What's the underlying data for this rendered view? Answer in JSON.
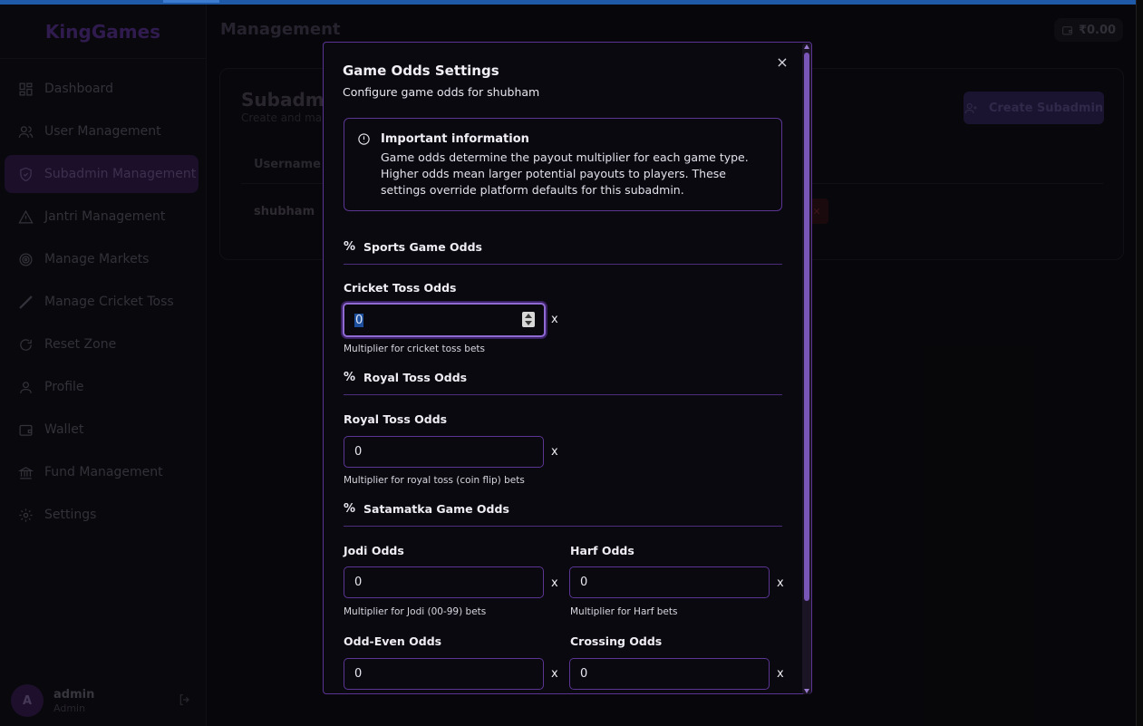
{
  "app": {
    "logo": "KingGames"
  },
  "sidebar": {
    "items": [
      {
        "label": "Dashboard",
        "icon": "dashboard-icon"
      },
      {
        "label": "User Management",
        "icon": "users-icon"
      },
      {
        "label": "Subadmin Management",
        "icon": "shield-icon",
        "active": true
      },
      {
        "label": "Jantri Management",
        "icon": "warning-triangle-icon"
      },
      {
        "label": "Manage Markets",
        "icon": "target-icon"
      },
      {
        "label": "Manage Cricket Toss",
        "icon": "bat-icon"
      },
      {
        "label": "Reset Zone",
        "icon": "refresh-icon"
      },
      {
        "label": "Profile",
        "icon": "user-icon"
      },
      {
        "label": "Wallet",
        "icon": "wallet-icon"
      },
      {
        "label": "Fund Management",
        "icon": "bank-icon"
      },
      {
        "label": "Settings",
        "icon": "gear-icon"
      }
    ],
    "user": {
      "avatar": "A",
      "name": "admin",
      "role": "Admin"
    }
  },
  "header": {
    "title": "Management",
    "balance": "₹0.00"
  },
  "page": {
    "title": "Subadmin",
    "subtitle": "Create and mana",
    "create_button": "Create Subadmin",
    "table": {
      "columns": [
        "Username"
      ],
      "rows": [
        [
          "shubham"
        ]
      ]
    }
  },
  "modal": {
    "title": "Game Odds Settings",
    "subtitle": "Configure game odds for shubham",
    "close": "×",
    "info": {
      "title": "Important information",
      "text": "Game odds determine the payout multiplier for each game type. Higher odds mean larger potential payouts to players. These settings override platform defaults for this subadmin."
    },
    "sections": {
      "sports": "Sports Game Odds",
      "royal": "Royal Toss Odds",
      "satamatka": "Satamatka Game Odds"
    },
    "section_icon": "%",
    "suffix": "x",
    "fields": {
      "cricket_toss": {
        "label": "Cricket Toss Odds",
        "value": "0",
        "hint": "Multiplier for cricket toss bets"
      },
      "royal_toss": {
        "label": "Royal Toss Odds",
        "value": "0",
        "hint": "Multiplier for royal toss (coin flip) bets"
      },
      "jodi": {
        "label": "Jodi Odds",
        "value": "0",
        "hint": "Multiplier for Jodi (00-99) bets"
      },
      "harf": {
        "label": "Harf Odds",
        "value": "0",
        "hint": "Multiplier for Harf bets"
      },
      "odd_even": {
        "label": "Odd-Even Odds",
        "value": "0"
      },
      "crossing": {
        "label": "Crossing Odds",
        "value": "0"
      }
    }
  }
}
